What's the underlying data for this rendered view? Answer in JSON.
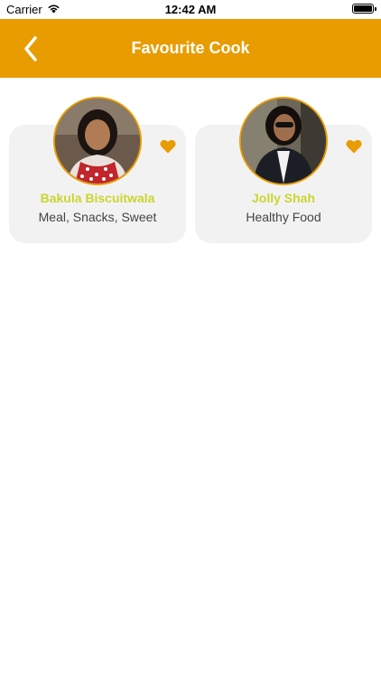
{
  "status_bar": {
    "carrier": "Carrier",
    "time": "12:42 AM"
  },
  "nav": {
    "title": "Favourite Cook",
    "back_icon": "chevron-left-icon"
  },
  "colors": {
    "accent": "#e89c00",
    "name": "#c9d62e",
    "card_bg": "#f3f2f3"
  },
  "cooks": [
    {
      "name": "Bakula Biscuitwala",
      "tags": "Meal, Snacks, Sweet",
      "favourite_icon": "heart-icon"
    },
    {
      "name": "Jolly Shah",
      "tags": "Healthy Food",
      "favourite_icon": "heart-icon"
    }
  ]
}
